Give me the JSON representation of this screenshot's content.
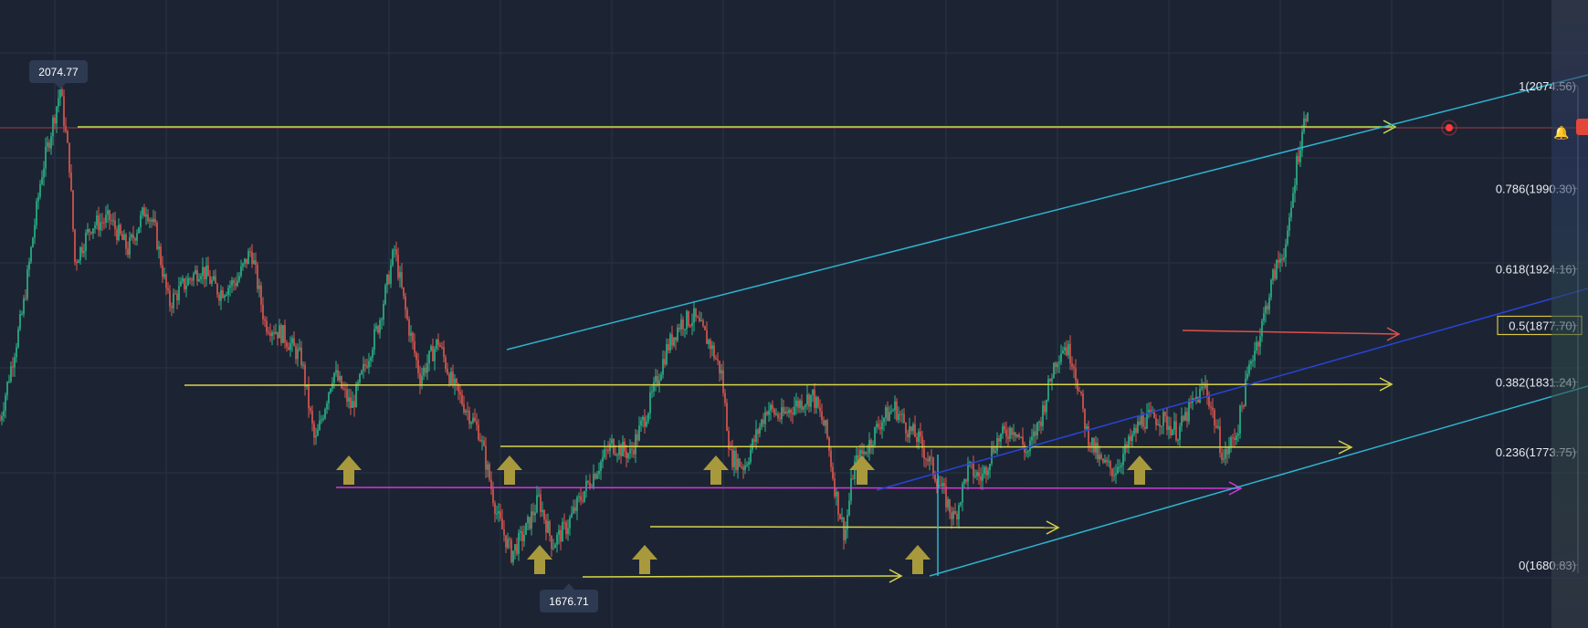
{
  "chart_data": {
    "type": "candlestick",
    "high_tag": "2074.77",
    "low_tag": "1676.71",
    "fib_levels": [
      {
        "label": "1(2074.56)",
        "value": 2074.56,
        "highlight": false
      },
      {
        "label": "0.786(1990.30)",
        "value": 1990.3,
        "highlight": false
      },
      {
        "label": "0.618(1924.16)",
        "value": 1924.16,
        "highlight": false
      },
      {
        "label": "0.5(1877.70)",
        "value": 1877.7,
        "highlight": true
      },
      {
        "label": "0.382(1831.24)",
        "value": 1831.24,
        "highlight": false
      },
      {
        "label": "0.236(1773.75)",
        "value": 1773.75,
        "highlight": false
      },
      {
        "label": "0(1680.83)",
        "value": 1680.83,
        "highlight": false
      }
    ],
    "price_path_x": [
      0,
      25,
      45,
      66,
      76,
      82,
      100,
      120,
      140,
      160,
      170,
      185,
      200,
      220,
      240,
      260,
      275,
      290,
      310,
      330,
      345,
      365,
      385,
      400,
      415,
      432,
      445,
      460,
      480,
      495,
      510,
      525,
      545,
      560,
      575,
      590,
      605,
      620,
      640,
      655,
      670,
      690,
      710,
      730,
      745,
      760,
      778,
      790,
      800,
      815,
      840,
      855,
      870,
      890,
      905,
      915,
      925,
      935,
      950,
      965,
      980,
      995,
      1005,
      1020,
      1030,
      1045,
      1060,
      1075,
      1090,
      1110,
      1125,
      1140,
      1155,
      1165,
      1175,
      1190,
      1205,
      1220,
      1235,
      1250,
      1270,
      1290,
      1305,
      1320,
      1330,
      1340,
      1355,
      1370,
      1380,
      1395,
      1410,
      1420,
      1432
    ],
    "price_path": [
      1800,
      1890,
      2000,
      2072,
      2010,
      1930,
      1960,
      1965,
      1940,
      1975,
      1955,
      1895,
      1910,
      1925,
      1905,
      1915,
      1940,
      1880,
      1870,
      1850,
      1780,
      1840,
      1810,
      1845,
      1880,
      1940,
      1885,
      1835,
      1865,
      1830,
      1810,
      1790,
      1720,
      1690,
      1708,
      1735,
      1698,
      1712,
      1742,
      1762,
      1780,
      1772,
      1810,
      1858,
      1880,
      1884,
      1862,
      1838,
      1770,
      1762,
      1810,
      1802,
      1812,
      1820,
      1790,
      1740,
      1705,
      1762,
      1778,
      1800,
      1810,
      1792,
      1785,
      1762,
      1745,
      1718,
      1760,
      1752,
      1782,
      1795,
      1772,
      1802,
      1848,
      1862,
      1850,
      1790,
      1765,
      1758,
      1778,
      1800,
      1802,
      1790,
      1812,
      1828,
      1800,
      1768,
      1792,
      1850,
      1872,
      1920,
      1948,
      2012,
      2060
    ],
    "grid": true
  }
}
